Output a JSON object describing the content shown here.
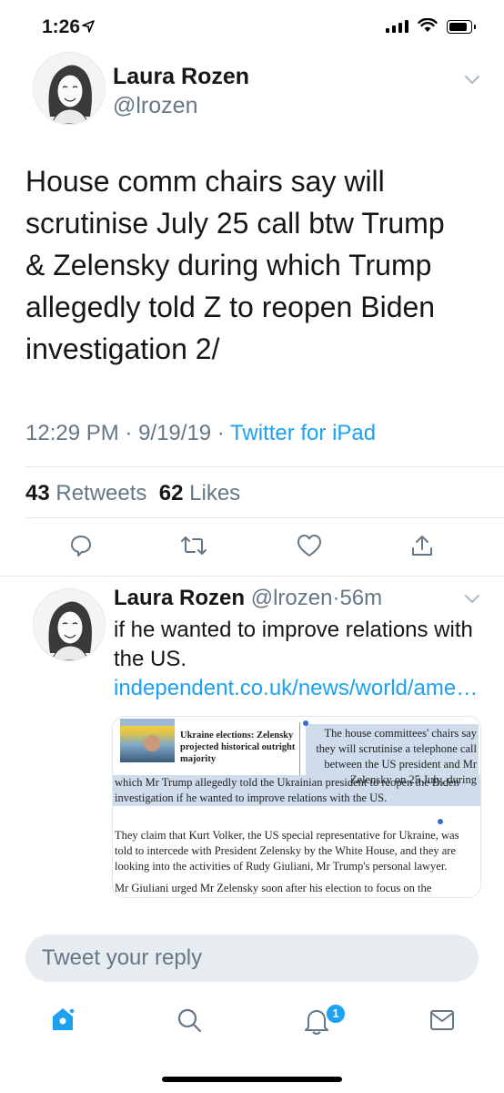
{
  "status_bar": {
    "time": "1:26"
  },
  "tweet": {
    "author_name": "Laura Rozen",
    "author_handle": "@lrozen",
    "text": "House comm chairs say will scrutinise July 25 call btw Trump & Zelensky during which Trump allegedly told Z to reopen Biden investigation 2/",
    "time": "12:29 PM",
    "date": "9/19/19",
    "source": "Twitter for iPad",
    "retweets_count": "43",
    "retweets_label": "Retweets",
    "likes_count": "62",
    "likes_label": "Likes"
  },
  "reply": {
    "author_name": "Laura Rozen",
    "author_handle": "@lrozen",
    "age": "56m",
    "text": "if he wanted to improve relations with the US.",
    "link": "independent.co.uk/news/world/ame…",
    "card": {
      "article_title": "Ukraine elections: Zelensky projected historical outright majority",
      "para1_right": "The house committees' chairs say they will scrutinise a telephone call between the US president and Mr Zelensky on 25 July, during",
      "para1_full": "which Mr Trump allegedly told the Ukrainian president to reopen the Biden investigation if he wanted to improve relations with the US.",
      "para2": "They claim that Kurt Volker, the US special representative for Ukraine, was told to intercede with President Zelensky by the White House, and they are looking into the activities of Rudy Giuliani, Mr Trump's personal lawyer.",
      "para3": "Mr Giuliani urged Mr Zelensky soon after his election to focus on the"
    }
  },
  "compose": {
    "placeholder": "Tweet your reply"
  },
  "tabbar": {
    "notifications_badge": "1"
  },
  "colors": {
    "accent": "#1da1f2",
    "secondary_text": "#657786",
    "divider": "#e1e8ed"
  }
}
